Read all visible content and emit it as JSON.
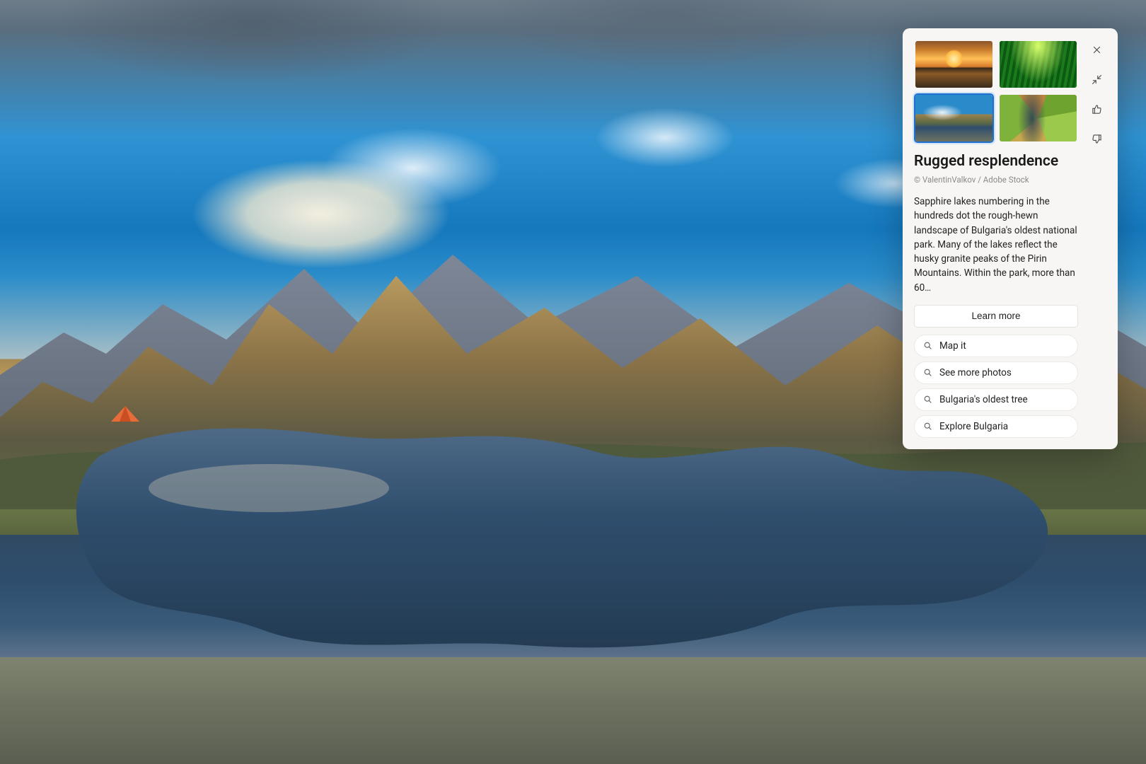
{
  "card": {
    "title": "Rugged resplendence",
    "credit": "© ValentinValkov / Adobe Stock",
    "description": "Sapphire lakes numbering in the hundreds dot the rough-hewn landscape of Bulgaria's oldest national park. Many of the lakes reflect the husky granite peaks of the Pirin Mountains. Within the park, more than 60…",
    "learn_more_label": "Learn more",
    "searches": [
      "Map it",
      "See more photos",
      "Bulgaria's oldest tree",
      "Explore Bulgaria"
    ],
    "thumbnails": [
      {
        "name": "sunset-reflection",
        "selected": false
      },
      {
        "name": "bamboo-path",
        "selected": false
      },
      {
        "name": "pirin-lake",
        "selected": true
      },
      {
        "name": "aerial-fields",
        "selected": false
      }
    ]
  }
}
